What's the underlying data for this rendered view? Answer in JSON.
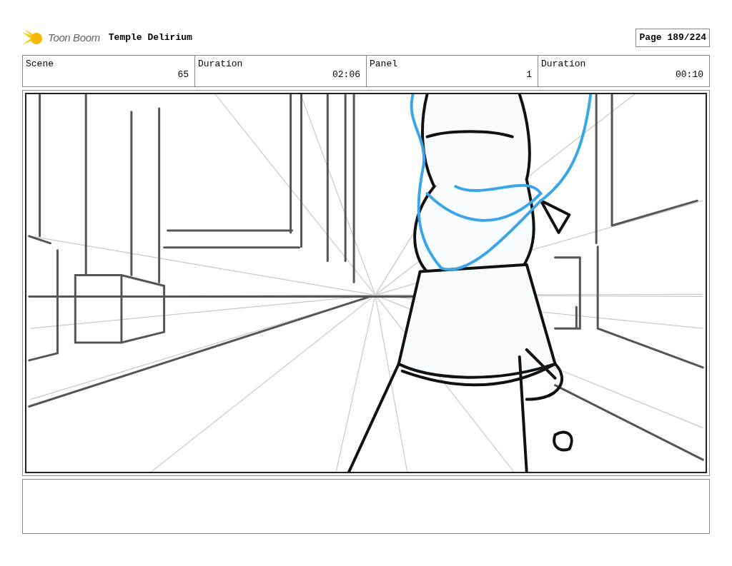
{
  "header": {
    "logo": "Toon Boom",
    "title": "Temple Delirium",
    "page": "Page 189/224"
  },
  "fields": [
    {
      "label": "Scene",
      "value": "65"
    },
    {
      "label": "Duration",
      "value": "02:06"
    },
    {
      "label": "Panel",
      "value": "1"
    },
    {
      "label": "Duration",
      "value": "00:10"
    }
  ]
}
